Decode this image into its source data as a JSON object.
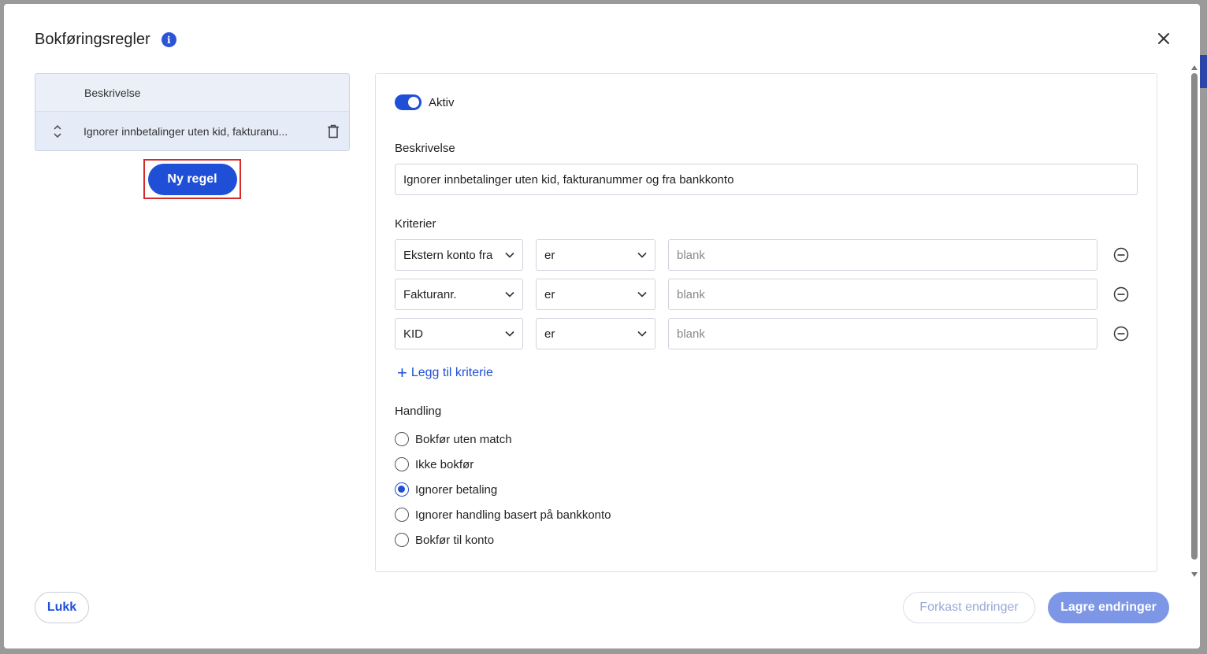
{
  "dialog": {
    "title": "Bokføringsregler"
  },
  "rule_list": {
    "header": "Beskrivelse",
    "rows": [
      {
        "label": "Ignorer innbetalinger uten kid, fakturanu..."
      }
    ],
    "new_rule_label": "Ny regel"
  },
  "editor": {
    "active_label": "Aktiv",
    "active": true,
    "description_label": "Beskrivelse",
    "description_value": "Ignorer innbetalinger uten kid, fakturanummer og fra bankkonto",
    "criteria_label": "Kriterier",
    "criteria": [
      {
        "field": "Ekstern konto fra",
        "operator": "er",
        "value_placeholder": "blank"
      },
      {
        "field": "Fakturanr.",
        "operator": "er",
        "value_placeholder": "blank"
      },
      {
        "field": "KID",
        "operator": "er",
        "value_placeholder": "blank"
      }
    ],
    "add_criterion_label": "Legg til kriterie",
    "action_label": "Handling",
    "actions": [
      {
        "label": "Bokfør uten match",
        "checked": false
      },
      {
        "label": "Ikke bokfør",
        "checked": false
      },
      {
        "label": "Ignorer betaling",
        "checked": true
      },
      {
        "label": "Ignorer handling basert på bankkonto",
        "checked": false
      },
      {
        "label": "Bokfør til konto",
        "checked": false
      }
    ]
  },
  "footer": {
    "close_label": "Lukk",
    "discard_label": "Forkast endringer",
    "save_label": "Lagre endringer"
  },
  "colors": {
    "primary": "#1f4fd6",
    "save_disabled": "#7d97e6",
    "highlight_border": "#d42a2a"
  }
}
